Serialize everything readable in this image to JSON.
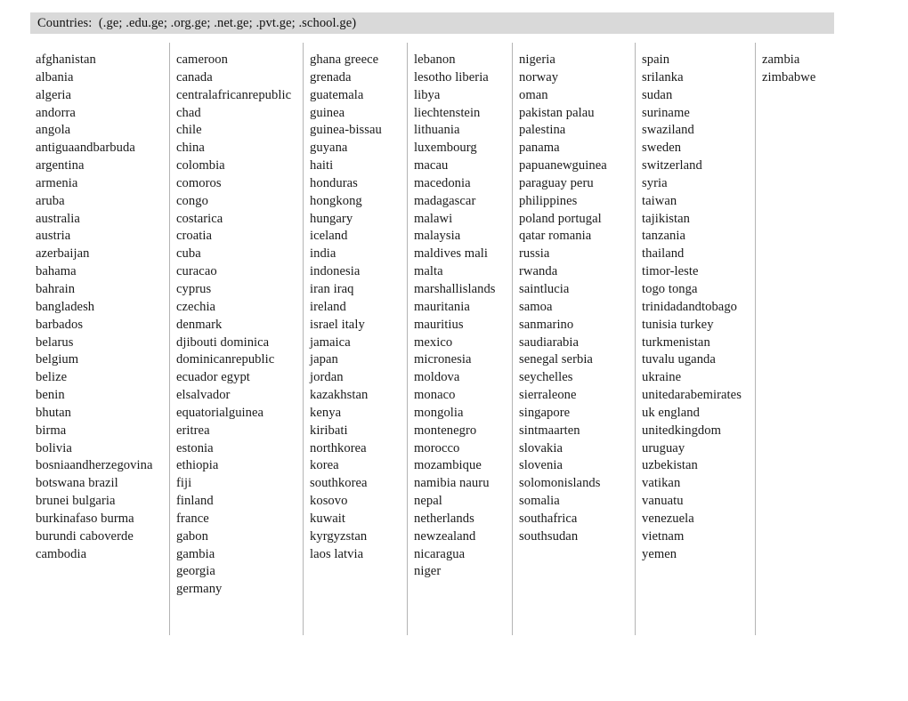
{
  "header": {
    "label": "Countries:",
    "tlds": "(.ge; .edu.ge; .org.ge; .net.ge; .pvt.ge; .school.ge)",
    "full_text": "Countries:  (.ge; .edu.ge; .org.ge; .net.ge; .pvt.ge; .school.ge)",
    "background_color": "#d9d9d9",
    "text_color": "#111111"
  },
  "page": {
    "background_color": "#ffffff",
    "rule_color": "#b4b4b4",
    "text_color": "#1a1a1a"
  },
  "columns": [
    {
      "index": 0,
      "has_left_rule": false,
      "items": [
        "afghanistan",
        "albania",
        "algeria",
        "andorra",
        "angola",
        "antiguaandbarbuda",
        "argentina",
        "armenia",
        "aruba",
        "australia",
        "austria",
        "azerbaijan",
        "bahama",
        "bahrain",
        "bangladesh",
        "barbados",
        "belarus",
        "belgium",
        "belize",
        "benin",
        "bhutan",
        "birma",
        "bolivia",
        "bosniaandherzegovina",
        "botswana brazil",
        "brunei bulgaria",
        "burkinafaso burma",
        "burundi caboverde",
        "cambodia"
      ]
    },
    {
      "index": 1,
      "has_left_rule": true,
      "items": [
        "cameroon",
        "canada",
        "centralafricanrepublic",
        "chad",
        "chile",
        "china",
        "colombia",
        "comoros",
        "congo",
        "costarica",
        "croatia",
        "cuba",
        "curacao",
        "cyprus",
        "czechia",
        "denmark",
        "djibouti dominica",
        "dominicanrepublic",
        "ecuador egypt",
        "elsalvador",
        "equatorialguinea",
        "eritrea",
        "estonia",
        "ethiopia",
        "fiji",
        "finland",
        "france",
        "gabon",
        "gambia",
        "georgia",
        "germany"
      ]
    },
    {
      "index": 2,
      "has_left_rule": true,
      "items": [
        "ghana greece",
        "grenada",
        "guatemala",
        "guinea",
        "guinea-bissau",
        "guyana",
        "haiti",
        "honduras",
        "hongkong",
        "hungary",
        "iceland",
        "india",
        "indonesia",
        "iran iraq",
        "ireland",
        "israel italy",
        "jamaica",
        "japan",
        "jordan",
        "kazakhstan",
        "kenya",
        "kiribati",
        "northkorea",
        "korea",
        "southkorea",
        "kosovo",
        "kuwait",
        "kyrgyzstan",
        "laos latvia"
      ]
    },
    {
      "index": 3,
      "has_left_rule": true,
      "items": [
        "lebanon",
        "lesotho liberia",
        "libya",
        "liechtenstein",
        "lithuania",
        "luxembourg",
        "macau",
        "macedonia",
        "madagascar",
        "malawi",
        "malaysia",
        "maldives mali",
        "malta",
        "marshallislands",
        "mauritania",
        "mauritius",
        "mexico",
        "micronesia",
        "moldova",
        "monaco",
        "mongolia",
        "montenegro",
        "morocco",
        "mozambique",
        "namibia nauru",
        "nepal",
        "netherlands",
        "newzealand",
        "nicaragua",
        "niger"
      ]
    },
    {
      "index": 4,
      "has_left_rule": true,
      "items": [
        "nigeria",
        "norway",
        "oman",
        "pakistan palau",
        "palestina",
        "panama",
        "papuanewguinea",
        "paraguay peru",
        "philippines",
        "poland portugal",
        "qatar romania",
        "russia",
        "rwanda",
        "saintlucia",
        "samoa",
        "sanmarino",
        "saudiarabia",
        "senegal serbia",
        "seychelles",
        "sierraleone",
        "singapore",
        "sintmaarten",
        "slovakia",
        "slovenia",
        "solomonislands",
        "somalia",
        "southafrica",
        "southsudan"
      ]
    },
    {
      "index": 5,
      "has_left_rule": true,
      "items": [
        "spain",
        "srilanka",
        "sudan",
        "suriname",
        "swaziland",
        "sweden",
        "switzerland",
        "syria",
        "taiwan",
        "tajikistan",
        "tanzania",
        "thailand",
        "timor-leste",
        "togo tonga",
        "trinidadandtobago",
        "tunisia turkey",
        "turkmenistan",
        "tuvalu uganda",
        "ukraine",
        "unitedarabemirates",
        "uk england",
        "unitedkingdom",
        "uruguay",
        "uzbekistan",
        "vatikan",
        "vanuatu",
        "venezuela",
        "vietnam",
        "yemen"
      ]
    },
    {
      "index": 6,
      "has_left_rule": true,
      "items": [
        "zambia",
        "zimbabwe"
      ]
    }
  ]
}
